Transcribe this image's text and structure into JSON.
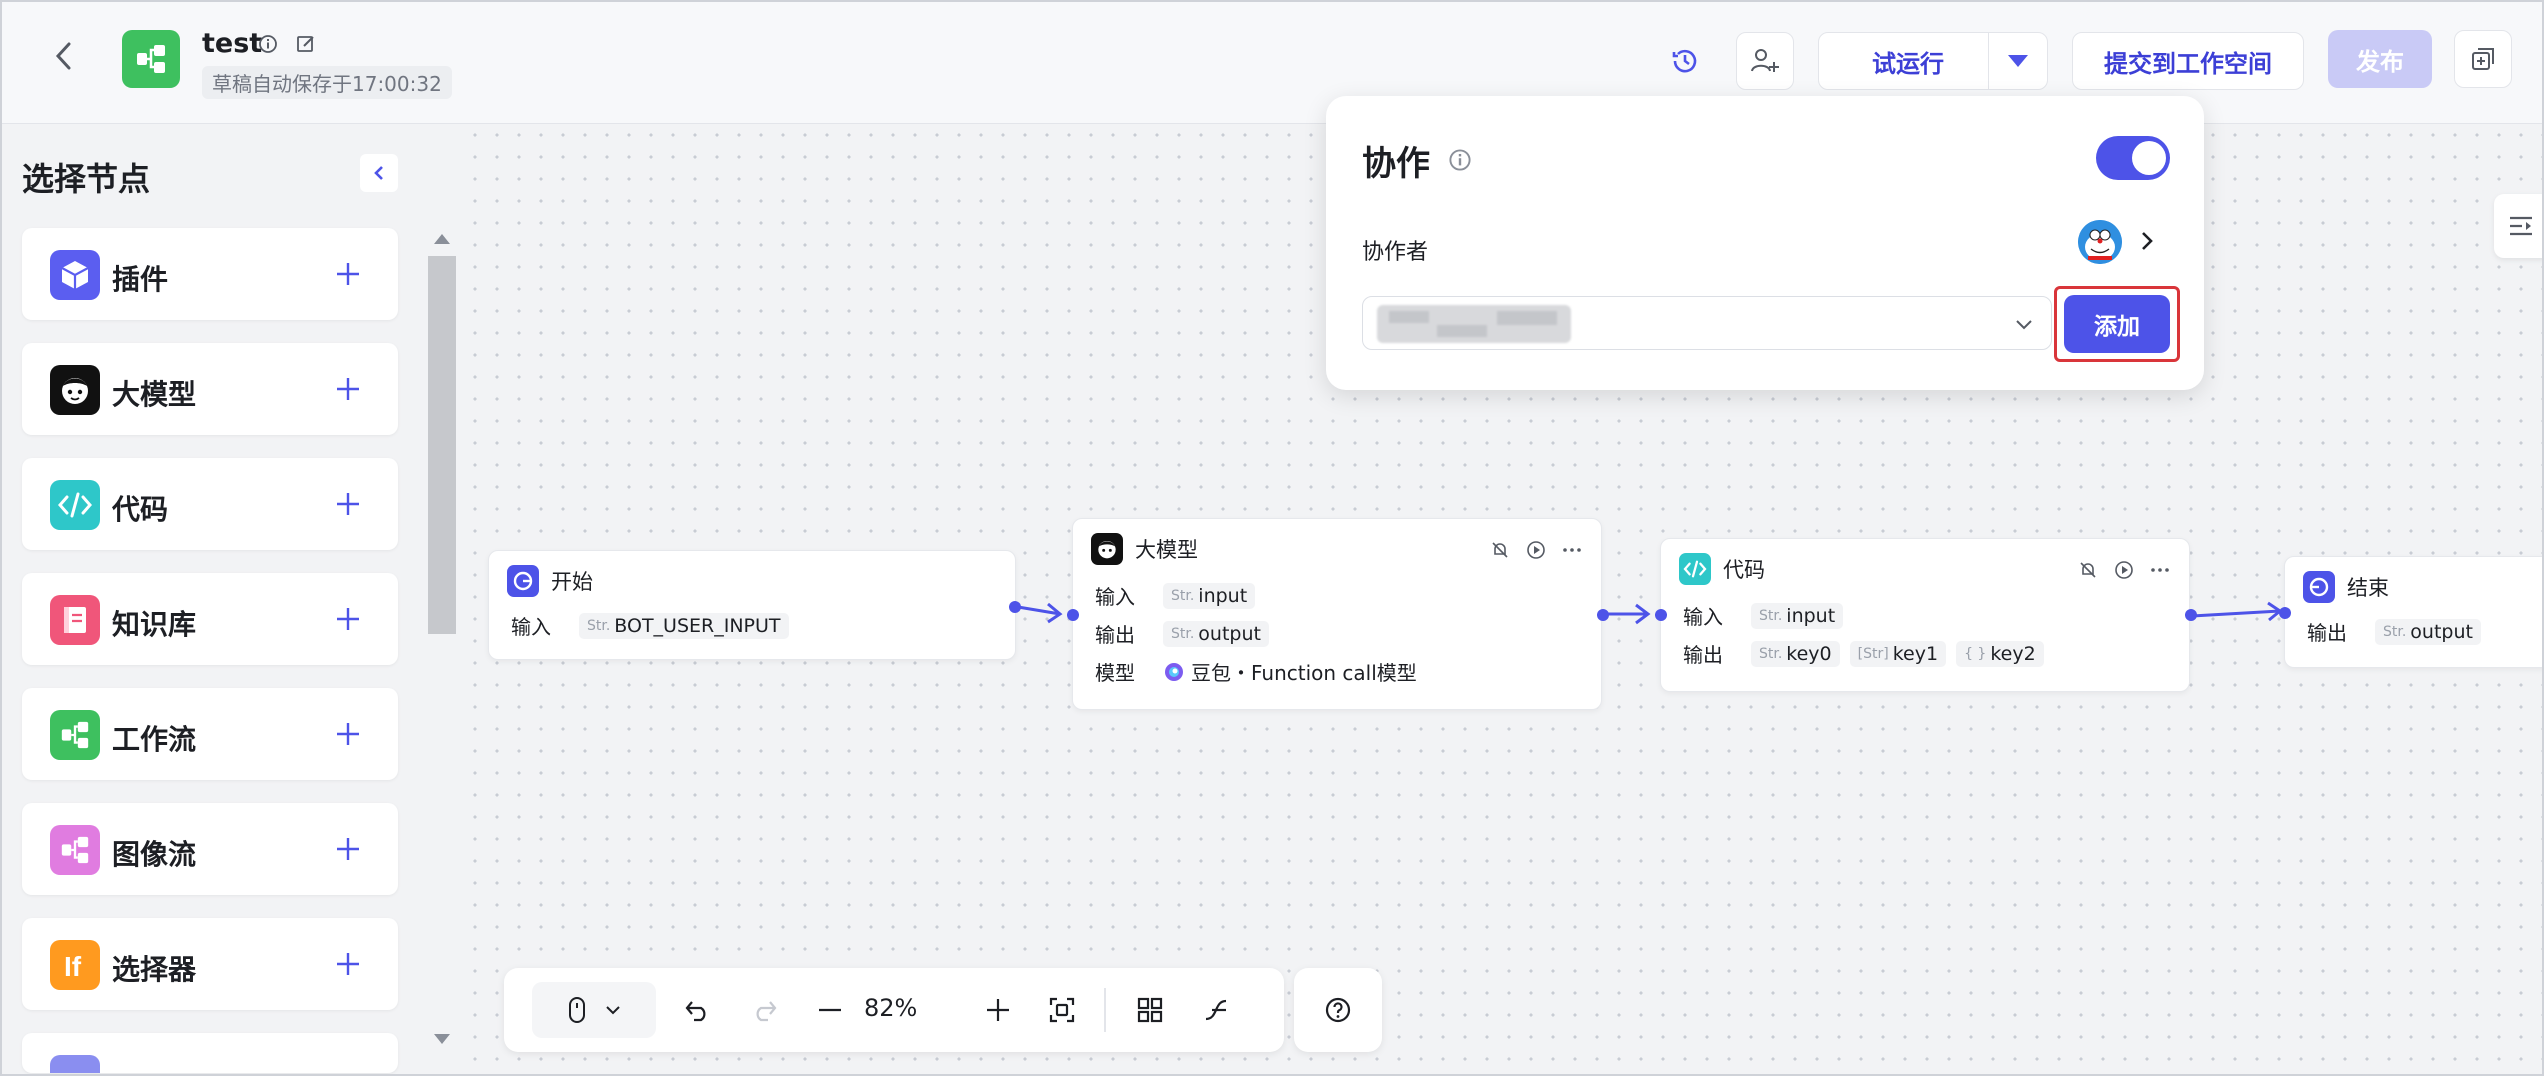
{
  "header": {
    "app_title": "test",
    "save_status": "草稿自动保存于17:00:32",
    "test_run_label": "试运行",
    "submit_label": "提交到工作空间",
    "publish_label": "发布"
  },
  "sidebar": {
    "title": "选择节点",
    "items": [
      {
        "label": "插件",
        "icon": "plugin-cube-icon",
        "color": "#5b5ef0"
      },
      {
        "label": "大模型",
        "icon": "llm-face-icon",
        "color": "#111111"
      },
      {
        "label": "代码",
        "icon": "code-icon",
        "color": "#2ec7c9"
      },
      {
        "label": "知识库",
        "icon": "knowledge-book-icon",
        "color": "#f0567a"
      },
      {
        "label": "工作流",
        "icon": "workflow-icon",
        "color": "#3ec05f"
      },
      {
        "label": "图像流",
        "icon": "imageflow-icon",
        "color": "#e07ce0"
      },
      {
        "label": "选择器",
        "icon": "if-selector-icon",
        "color": "#ff9a1f"
      }
    ]
  },
  "flow": {
    "start": {
      "title": "开始",
      "input_label": "输入",
      "input_type": "Str.",
      "input_value": "BOT_USER_INPUT"
    },
    "llm": {
      "title": "大模型",
      "input_label": "输入",
      "input_type": "Str.",
      "input_value": "input",
      "output_label": "输出",
      "output_type": "Str.",
      "output_value": "output",
      "model_label": "模型",
      "model_value": "豆包・Function call模型"
    },
    "code": {
      "title": "代码",
      "input_label": "输入",
      "input_type": "Str.",
      "input_value": "input",
      "output_label": "输出",
      "output_type_1": "Str.",
      "output_1": "key0",
      "output_type_2": "[Str]",
      "output_2": "key1",
      "output_type_3": "{ }",
      "output_3": "key2"
    },
    "end": {
      "title": "结束",
      "output_label": "输出",
      "output_type": "Str.",
      "output_value": "output"
    }
  },
  "toolbar": {
    "zoom": "82%"
  },
  "popup": {
    "title": "协作",
    "toggle_on": true,
    "collaborators_label": "协作者",
    "add_label": "添加"
  },
  "colors": {
    "accent": "#4d53e8",
    "highlight": "#d9353a"
  }
}
